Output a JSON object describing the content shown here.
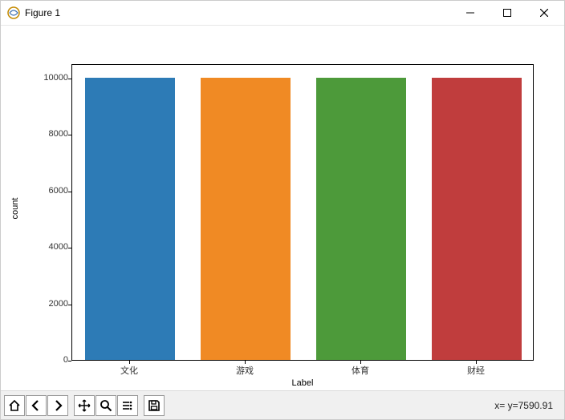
{
  "window": {
    "title": "Figure 1"
  },
  "chart_data": {
    "type": "bar",
    "categories": [
      "文化",
      "游戏",
      "体育",
      "财经"
    ],
    "values": [
      10000,
      10000,
      10000,
      10000
    ],
    "colors": [
      "#2d7bb6",
      "#f08a24",
      "#4d9a3a",
      "#c03d3d"
    ],
    "xlabel": "Label",
    "ylabel": "count",
    "yticks": [
      0,
      2000,
      4000,
      6000,
      8000,
      10000
    ],
    "ylim": [
      0,
      10500
    ]
  },
  "toolbar": {
    "icons": [
      "home-icon",
      "back-icon",
      "forward-icon",
      "pan-icon",
      "zoom-icon",
      "subplots-icon",
      "save-icon"
    ]
  },
  "status": {
    "text": "x=  y=7590.91"
  }
}
